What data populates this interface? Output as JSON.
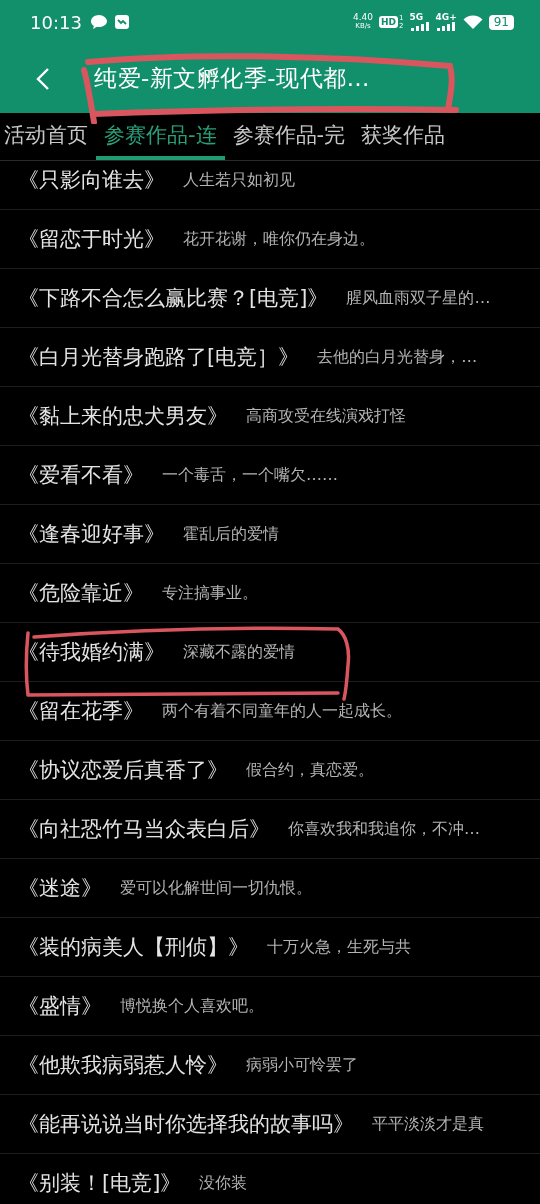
{
  "status_bar": {
    "time": "10:13",
    "speed_value": "4.40",
    "speed_unit": "KB/s",
    "hd_badge": "HD",
    "sim_slots": [
      "1",
      "2"
    ],
    "network_1": "5G",
    "network_2": "4G+",
    "battery": "91"
  },
  "header": {
    "title": "纯爱-新文孵化季-现代都…",
    "circled": true
  },
  "tabs": [
    {
      "label": "活动首页",
      "selected": false
    },
    {
      "label": "参赛作品-连",
      "selected": true
    },
    {
      "label": "参赛作品-完",
      "selected": false
    },
    {
      "label": "获奖作品",
      "selected": false
    }
  ],
  "rows": [
    {
      "title": "《只影向谁去》",
      "description": "人生若只如初见",
      "circled": false
    },
    {
      "title": "《留恋于时光》",
      "description": "花开花谢，唯你仍在身边。",
      "circled": false
    },
    {
      "title": "《下路不合怎么赢比赛？[电竞]》",
      "description": "腥风血雨双子星的…",
      "circled": false
    },
    {
      "title": "《白月光替身跑路了[电竞］》",
      "description": "去他的白月光替身，…",
      "circled": false
    },
    {
      "title": "《黏上来的忠犬男友》",
      "description": "高商攻受在线演戏打怪",
      "circled": false
    },
    {
      "title": "《爱看不看》",
      "description": "一个毒舌，一个嘴欠……",
      "circled": false
    },
    {
      "title": "《逢春迎好事》",
      "description": "霍乱后的爱情",
      "circled": false
    },
    {
      "title": "《危险靠近》",
      "description": "专注搞事业。",
      "circled": false
    },
    {
      "title": "《待我婚约满》",
      "description": "深藏不露的爱情",
      "circled": true
    },
    {
      "title": "《留在花季》",
      "description": "两个有着不同童年的人一起成长。",
      "circled": false
    },
    {
      "title": "《协议恋爱后真香了》",
      "description": "假合约，真恋爱。",
      "circled": false
    },
    {
      "title": "《向社恐竹马当众表白后》",
      "description": "你喜欢我和我追你，不冲…",
      "circled": false
    },
    {
      "title": "《迷途》",
      "description": "爱可以化解世间一切仇恨。",
      "circled": false
    },
    {
      "title": "《装的病美人【刑侦】》",
      "description": "十万火急，生死与共",
      "circled": false
    },
    {
      "title": "《盛情》",
      "description": "博悦换个人喜欢吧。",
      "circled": false
    },
    {
      "title": "《他欺我病弱惹人怜》",
      "description": "病弱小可怜罢了",
      "circled": false
    },
    {
      "title": "《能再说说当时你选择我的故事吗》",
      "description": "平平淡淡才是真",
      "circled": false
    },
    {
      "title": "《别装！[电竞]》",
      "description": "没你装",
      "circled": false
    }
  ]
}
